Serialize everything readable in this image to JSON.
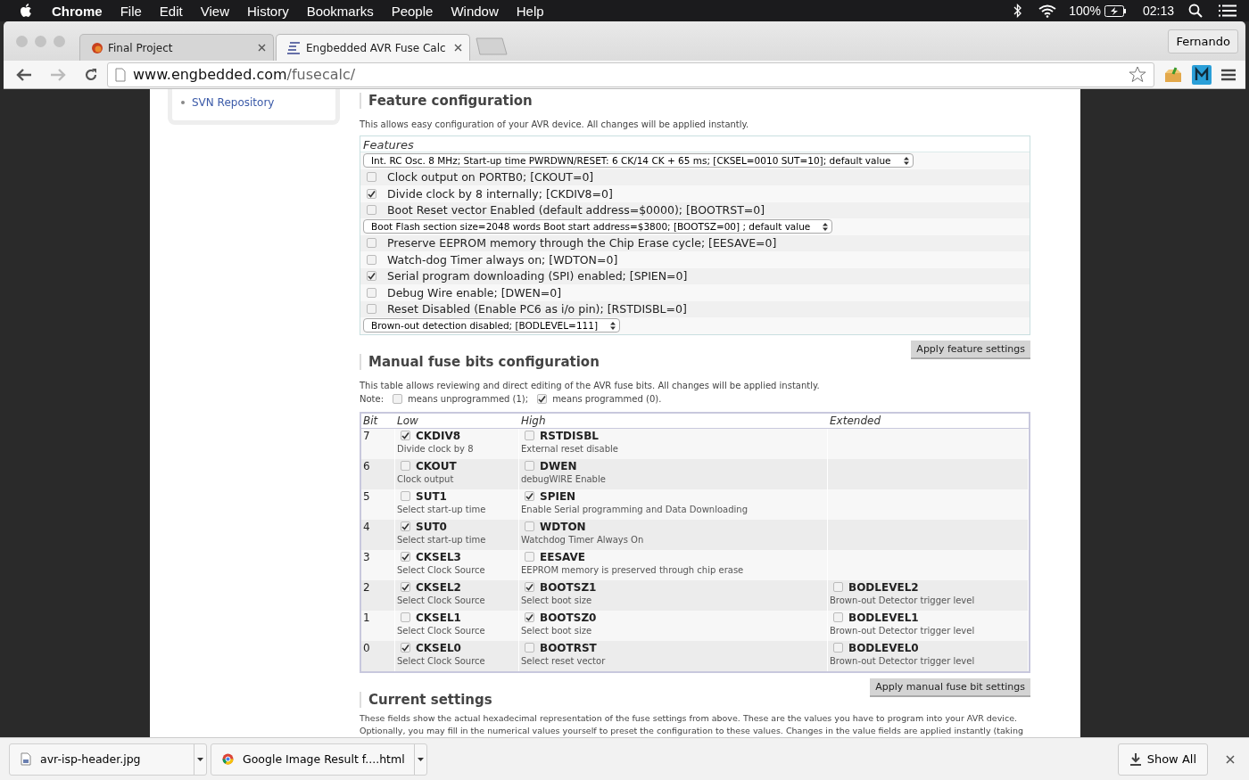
{
  "menubar": {
    "app": "Chrome",
    "items": [
      "File",
      "Edit",
      "View",
      "History",
      "Bookmarks",
      "People",
      "Window",
      "Help"
    ],
    "battery": "100%",
    "time": "02:13"
  },
  "browser": {
    "tabs": [
      {
        "title": "Final Project",
        "selected": false
      },
      {
        "title": "Engbedded AVR Fuse Calc",
        "selected": true
      }
    ],
    "profile": "Fernando",
    "url": {
      "host": "www.engbedded.com",
      "path": "/fusecalc/"
    }
  },
  "sidebar": {
    "links": [
      "SVN Repository"
    ]
  },
  "features": {
    "title": "Feature configuration",
    "description": "This allows easy configuration of your AVR device. All changes will be applied instantly.",
    "legend": "Features",
    "rows": [
      {
        "kind": "select",
        "text": "Int. RC Osc. 8 MHz; Start-up time PWRDWN/RESET: 6 CK/14 CK + 65 ms; [CKSEL=0010 SUT=10]; default value"
      },
      {
        "kind": "checkbox",
        "text": "Clock output on PORTB0; [CKOUT=0]",
        "checked": false
      },
      {
        "kind": "checkbox",
        "text": "Divide clock by 8 internally; [CKDIV8=0]",
        "checked": true
      },
      {
        "kind": "checkbox",
        "text": "Boot Reset vector Enabled (default address=$0000); [BOOTRST=0]",
        "checked": false
      },
      {
        "kind": "select",
        "text": "Boot Flash section size=2048 words Boot start address=$3800; [BOOTSZ=00] ; default value"
      },
      {
        "kind": "checkbox",
        "text": "Preserve EEPROM memory through the Chip Erase cycle; [EESAVE=0]",
        "checked": false
      },
      {
        "kind": "checkbox",
        "text": "Watch-dog Timer always on; [WDTON=0]",
        "checked": false
      },
      {
        "kind": "checkbox",
        "text": "Serial program downloading (SPI) enabled; [SPIEN=0]",
        "checked": true
      },
      {
        "kind": "checkbox",
        "text": "Debug Wire enable; [DWEN=0]",
        "checked": false
      },
      {
        "kind": "checkbox",
        "text": "Reset Disabled (Enable PC6 as i/o pin); [RSTDISBL=0]",
        "checked": false
      },
      {
        "kind": "select",
        "text": "Brown-out detection disabled; [BODLEVEL=111]"
      }
    ],
    "button": "Apply feature settings"
  },
  "manual": {
    "title": "Manual fuse bits configuration",
    "description": "This table allows reviewing and direct editing of the AVR fuse bits. All changes will be applied instantly.",
    "note": {
      "prefix": "Note:",
      "items": [
        {
          "text": "means unprogrammed (1);",
          "checked": false
        },
        {
          "text": "means programmed (0).",
          "checked": true
        }
      ]
    },
    "columns": [
      "Bit",
      "Low",
      "High",
      "Extended"
    ],
    "rows": [
      {
        "bit": "7",
        "low": {
          "name": "CKDIV8",
          "desc": "Divide clock by 8",
          "checked": true
        },
        "high": {
          "name": "RSTDISBL",
          "desc": "External reset disable",
          "checked": false
        }
      },
      {
        "bit": "6",
        "low": {
          "name": "CKOUT",
          "desc": "Clock output",
          "checked": false
        },
        "high": {
          "name": "DWEN",
          "desc": "debugWIRE Enable",
          "checked": false
        }
      },
      {
        "bit": "5",
        "low": {
          "name": "SUT1",
          "desc": "Select start-up time",
          "checked": false
        },
        "high": {
          "name": "SPIEN",
          "desc": "Enable Serial programming and Data Downloading",
          "checked": true
        }
      },
      {
        "bit": "4",
        "low": {
          "name": "SUT0",
          "desc": "Select start-up time",
          "checked": true
        },
        "high": {
          "name": "WDTON",
          "desc": "Watchdog Timer Always On",
          "checked": false
        }
      },
      {
        "bit": "3",
        "low": {
          "name": "CKSEL3",
          "desc": "Select Clock Source",
          "checked": true
        },
        "high": {
          "name": "EESAVE",
          "desc": "EEPROM memory is preserved through chip erase",
          "checked": false
        }
      },
      {
        "bit": "2",
        "low": {
          "name": "CKSEL2",
          "desc": "Select Clock Source",
          "checked": true
        },
        "high": {
          "name": "BOOTSZ1",
          "desc": "Select boot size",
          "checked": true
        },
        "extended": {
          "name": "BODLEVEL2",
          "desc": "Brown-out Detector trigger level",
          "checked": false
        }
      },
      {
        "bit": "1",
        "low": {
          "name": "CKSEL1",
          "desc": "Select Clock Source",
          "checked": false
        },
        "high": {
          "name": "BOOTSZ0",
          "desc": "Select boot size",
          "checked": true
        },
        "extended": {
          "name": "BODLEVEL1",
          "desc": "Brown-out Detector trigger level",
          "checked": false
        }
      },
      {
        "bit": "0",
        "low": {
          "name": "CKSEL0",
          "desc": "Select Clock Source",
          "checked": true
        },
        "high": {
          "name": "BOOTRST",
          "desc": "Select reset vector",
          "checked": false
        },
        "extended": {
          "name": "BODLEVEL0",
          "desc": "Brown-out Detector trigger level",
          "checked": false
        }
      }
    ],
    "button": "Apply manual fuse bit settings"
  },
  "current": {
    "title": "Current settings",
    "lines": [
      "These fields show the actual hexadecimal representation of the fuse settings from above. These are the values you have to program into your AVR device.",
      "Optionally, you may fill in the numerical values yourself to preset the configuration to these values. Changes in the value fields are applied instantly (taking"
    ]
  },
  "downloads": {
    "items": [
      {
        "name": "avr-isp-header.jpg",
        "kind": "image"
      },
      {
        "name": "Google Image Result f....html",
        "kind": "web"
      }
    ],
    "show_all": "Show All"
  }
}
